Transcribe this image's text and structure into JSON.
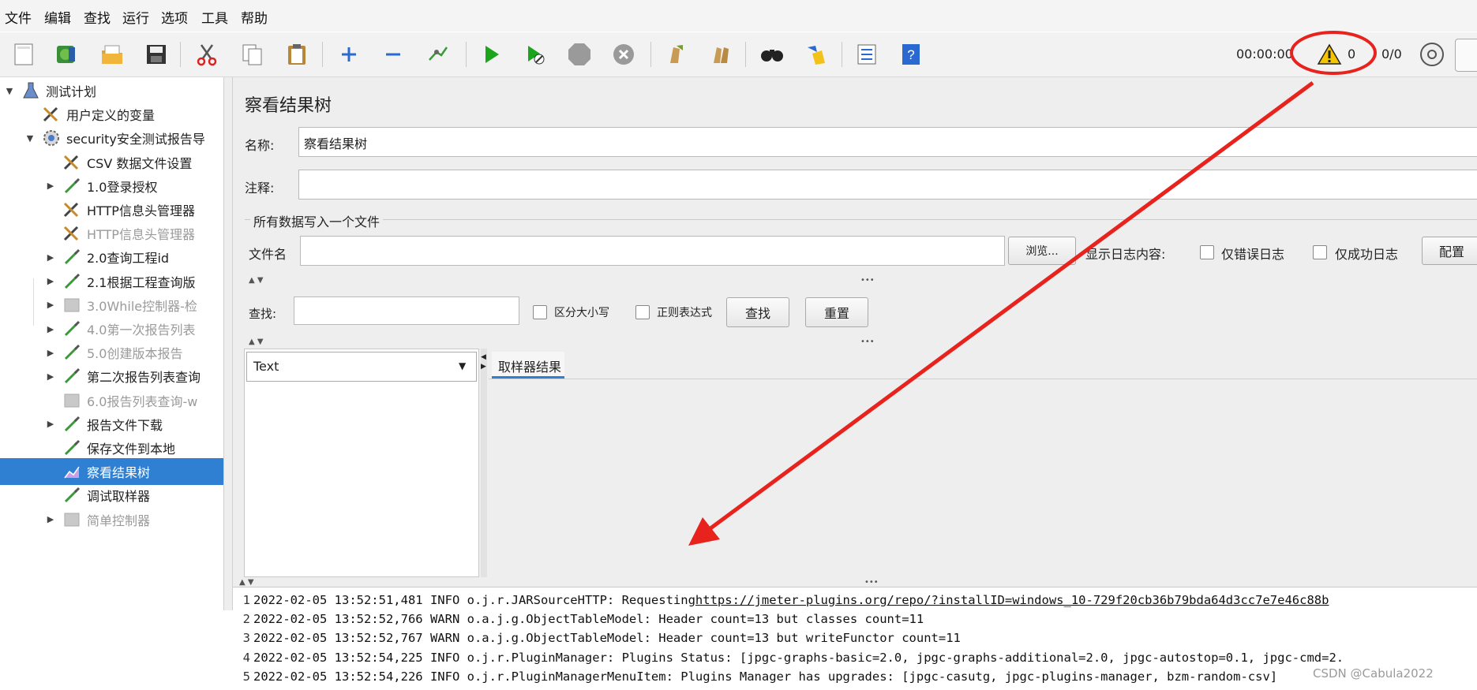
{
  "menu": [
    "文件",
    "编辑",
    "查找",
    "运行",
    "选项",
    "工具",
    "帮助"
  ],
  "toolbar": {
    "icons": [
      "new-icon",
      "templates-icon",
      "open-icon",
      "save-icon",
      "cut-icon",
      "copy-icon",
      "paste-icon",
      "expand-icon",
      "collapse-icon",
      "toggle-icon",
      "start-icon",
      "start-no-pauses-icon",
      "stop-icon",
      "shutdown-icon",
      "clear-icon",
      "clear-all-icon",
      "search-icon",
      "reset-search-icon",
      "function-helper-icon",
      "help-icon"
    ],
    "timer": "00:00:00",
    "warning_count": "0",
    "threads": "0/0"
  },
  "tree": {
    "items": [
      {
        "label": "测试计划",
        "icon": "flask-icon",
        "arrow": "▼",
        "indent": 0,
        "disabled": false
      },
      {
        "label": "用户定义的变量",
        "icon": "tools-icon",
        "arrow": "",
        "indent": 1,
        "disabled": false
      },
      {
        "label": "security安全测试报告导",
        "icon": "gear-icon",
        "arrow": "▼",
        "indent": 1,
        "disabled": false
      },
      {
        "label": "CSV 数据文件设置",
        "icon": "tools-icon",
        "arrow": "",
        "indent": 2,
        "disabled": false
      },
      {
        "label": "1.0登录授权",
        "icon": "pipette-icon",
        "arrow": "▶",
        "indent": 2,
        "disabled": false
      },
      {
        "label": "HTTP信息头管理器",
        "icon": "tools-icon",
        "arrow": "",
        "indent": 2,
        "disabled": false
      },
      {
        "label": "HTTP信息头管理器",
        "icon": "tools-icon",
        "arrow": "",
        "indent": 2,
        "disabled": true
      },
      {
        "label": "2.0查询工程id",
        "icon": "pipette-icon",
        "arrow": "▶",
        "indent": 2,
        "disabled": false
      },
      {
        "label": "2.1根据工程查询版",
        "icon": "pipette-icon",
        "arrow": "▶",
        "indent": 2,
        "disabled": false
      },
      {
        "label": "3.0While控制器-检",
        "icon": "controller-icon",
        "arrow": "▶",
        "indent": 2,
        "disabled": true
      },
      {
        "label": "4.0第一次报告列表",
        "icon": "pipette-icon",
        "arrow": "▶",
        "indent": 2,
        "disabled": true
      },
      {
        "label": "5.0创建版本报告",
        "icon": "pipette-icon",
        "arrow": "▶",
        "indent": 2,
        "disabled": true
      },
      {
        "label": "第二次报告列表查询",
        "icon": "pipette-icon",
        "arrow": "▶",
        "indent": 2,
        "disabled": false
      },
      {
        "label": "6.0报告列表查询-w",
        "icon": "controller-icon",
        "arrow": "",
        "indent": 2,
        "disabled": true
      },
      {
        "label": "报告文件下载",
        "icon": "pipette-icon",
        "arrow": "▶",
        "indent": 2,
        "disabled": false
      },
      {
        "label": "保存文件到本地",
        "icon": "pipette-icon",
        "arrow": "",
        "indent": 2,
        "disabled": false
      },
      {
        "label": "察看结果树",
        "icon": "chart-icon",
        "arrow": "",
        "indent": 2,
        "disabled": false,
        "selected": true
      },
      {
        "label": "调试取样器",
        "icon": "pipette-icon",
        "arrow": "",
        "indent": 2,
        "disabled": false
      },
      {
        "label": "简单控制器",
        "icon": "controller-icon",
        "arrow": "▶",
        "indent": 2,
        "disabled": true
      }
    ]
  },
  "panel": {
    "title": "察看结果树",
    "name_label": "名称:",
    "name_value": "察看结果树",
    "comment_label": "注释:",
    "comment_value": "",
    "file_section": "所有数据写入一个文件",
    "filename_label": "文件名",
    "filename_value": "",
    "browse_button": "浏览...",
    "log_content_label": "显示日志内容:",
    "errors_only": "仅错误日志",
    "success_only": "仅成功日志",
    "config_button": "配置",
    "search_label": "查找:",
    "search_value": "",
    "case_sensitive": "区分大小写",
    "regex": "正则表达式",
    "find_button": "查找",
    "reset_button": "重置",
    "renderer_value": "Text",
    "result_tab": "取样器结果"
  },
  "log": {
    "lines": [
      {
        "num": "1",
        "text": "2022-02-05 13:52:51,481 INFO o.j.r.JARSourceHTTP: Requesting ",
        "link": "https://jmeter-plugins.org/repo/?installID=windows_10-729f20cb36b79bda64d3cc7e7e46c88b"
      },
      {
        "num": "2",
        "text": "2022-02-05 13:52:52,766 WARN o.a.j.g.ObjectTableModel: Header count=13 but classes count=11",
        "link": ""
      },
      {
        "num": "3",
        "text": "2022-02-05 13:52:52,767 WARN o.a.j.g.ObjectTableModel: Header count=13 but writeFunctor count=11",
        "link": ""
      },
      {
        "num": "4",
        "text": "2022-02-05 13:52:54,225 INFO o.j.r.PluginManager: Plugins Status: [jpgc-graphs-basic=2.0, jpgc-graphs-additional=2.0, jpgc-autostop=0.1, jpgc-cmd=2.",
        "link": ""
      },
      {
        "num": "5",
        "text": "2022-02-05 13:52:54,226 INFO o.j.r.PluginManagerMenuItem: Plugins Manager has upgrades: [jpgc-casutg, jpgc-plugins-manager, bzm-random-csv]",
        "link": ""
      }
    ],
    "watermark": "CSDN @Cabula2022"
  },
  "colors": {
    "selected": "#2f7fd2",
    "annotation": "#e8231d",
    "link": "#0033cc"
  }
}
